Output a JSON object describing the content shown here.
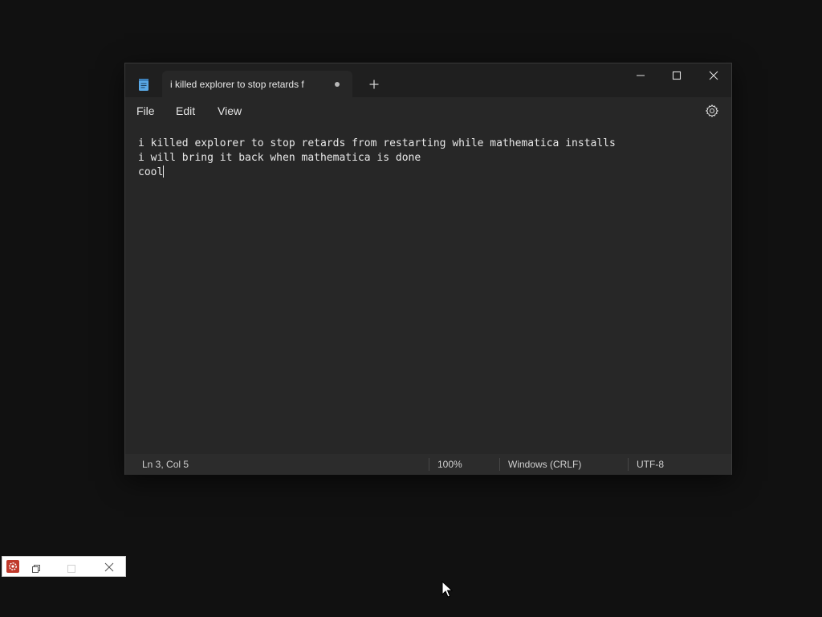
{
  "window": {
    "tab_title": "i killed explorer to stop retards f",
    "new_tab_icon": "plus-icon"
  },
  "menu": {
    "file": "File",
    "edit": "Edit",
    "view": "View"
  },
  "editor": {
    "lines": [
      "i killed explorer to stop retards from restarting while mathematica installs",
      "i will bring it back when mathematica is done",
      "cool"
    ]
  },
  "status": {
    "position": "Ln 3, Col 5",
    "zoom": "100%",
    "line_ending": "Windows (CRLF)",
    "encoding": "UTF-8"
  },
  "colors": {
    "window_bg": "#272727",
    "titlebar_bg": "#1f1f1f",
    "desktop_bg": "#111111",
    "notepad_icon": "#5aa9e6",
    "mini_icon": "#c0392b"
  }
}
